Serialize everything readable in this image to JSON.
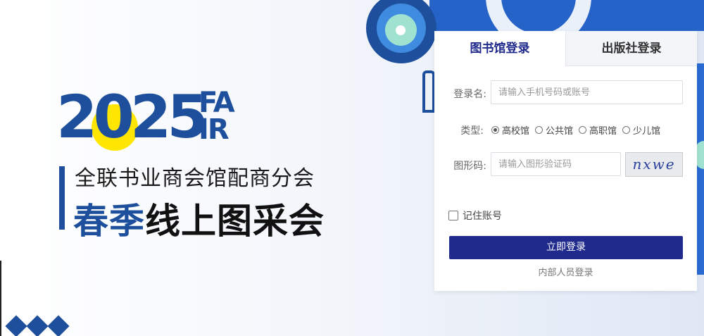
{
  "branding": {
    "year": "2025",
    "logo_letters_top": "FA",
    "logo_letters_bottom": "IR",
    "subtitle": "全联书业商会馆配商分会",
    "title_part1": "春季",
    "title_part2": "线上图采会"
  },
  "login": {
    "tabs": [
      {
        "label": "图书馆登录",
        "active": true
      },
      {
        "label": "出版社登录",
        "active": false
      }
    ],
    "username_label": "登录名:",
    "username_placeholder": "请输入手机号码或账号",
    "type_label": "类型:",
    "types": [
      {
        "label": "高校馆",
        "checked": true
      },
      {
        "label": "公共馆",
        "checked": false
      },
      {
        "label": "高职馆",
        "checked": false
      },
      {
        "label": "少儿馆",
        "checked": false
      }
    ],
    "captcha_label": "图形码:",
    "captcha_placeholder": "请输入图形验证码",
    "captcha_text": "nxwe",
    "remember_label": "记住账号",
    "submit_label": "立即登录",
    "internal_link": "内部人员登录"
  },
  "colors": {
    "brand_blue": "#1d4f9c",
    "button_navy": "#1f2a8c",
    "accent_yellow": "#ffe600"
  }
}
